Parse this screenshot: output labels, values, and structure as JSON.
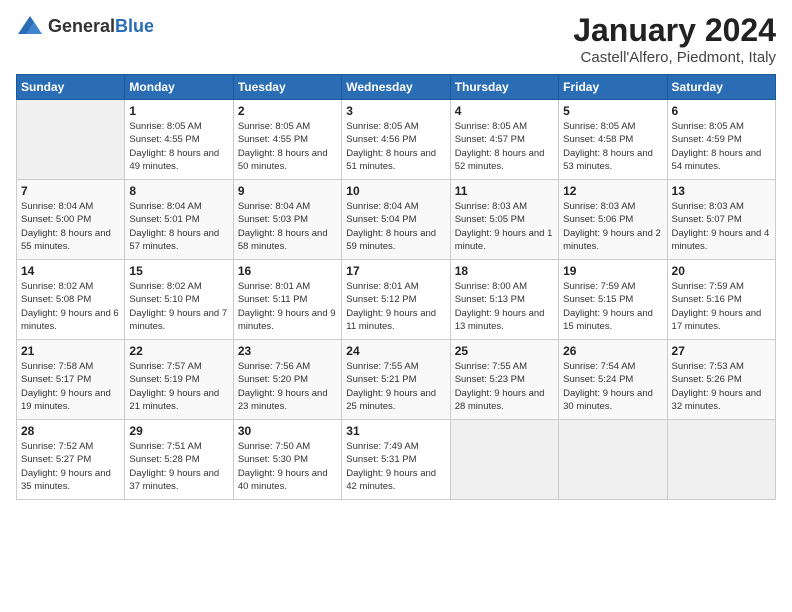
{
  "header": {
    "logo_general": "General",
    "logo_blue": "Blue",
    "month_year": "January 2024",
    "location": "Castell'Alfero, Piedmont, Italy"
  },
  "weekdays": [
    "Sunday",
    "Monday",
    "Tuesday",
    "Wednesday",
    "Thursday",
    "Friday",
    "Saturday"
  ],
  "weeks": [
    [
      {
        "day": "",
        "sunrise": "",
        "sunset": "",
        "daylight": ""
      },
      {
        "day": "1",
        "sunrise": "Sunrise: 8:05 AM",
        "sunset": "Sunset: 4:55 PM",
        "daylight": "Daylight: 8 hours and 49 minutes."
      },
      {
        "day": "2",
        "sunrise": "Sunrise: 8:05 AM",
        "sunset": "Sunset: 4:55 PM",
        "daylight": "Daylight: 8 hours and 50 minutes."
      },
      {
        "day": "3",
        "sunrise": "Sunrise: 8:05 AM",
        "sunset": "Sunset: 4:56 PM",
        "daylight": "Daylight: 8 hours and 51 minutes."
      },
      {
        "day": "4",
        "sunrise": "Sunrise: 8:05 AM",
        "sunset": "Sunset: 4:57 PM",
        "daylight": "Daylight: 8 hours and 52 minutes."
      },
      {
        "day": "5",
        "sunrise": "Sunrise: 8:05 AM",
        "sunset": "Sunset: 4:58 PM",
        "daylight": "Daylight: 8 hours and 53 minutes."
      },
      {
        "day": "6",
        "sunrise": "Sunrise: 8:05 AM",
        "sunset": "Sunset: 4:59 PM",
        "daylight": "Daylight: 8 hours and 54 minutes."
      }
    ],
    [
      {
        "day": "7",
        "sunrise": "Sunrise: 8:04 AM",
        "sunset": "Sunset: 5:00 PM",
        "daylight": "Daylight: 8 hours and 55 minutes."
      },
      {
        "day": "8",
        "sunrise": "Sunrise: 8:04 AM",
        "sunset": "Sunset: 5:01 PM",
        "daylight": "Daylight: 8 hours and 57 minutes."
      },
      {
        "day": "9",
        "sunrise": "Sunrise: 8:04 AM",
        "sunset": "Sunset: 5:03 PM",
        "daylight": "Daylight: 8 hours and 58 minutes."
      },
      {
        "day": "10",
        "sunrise": "Sunrise: 8:04 AM",
        "sunset": "Sunset: 5:04 PM",
        "daylight": "Daylight: 8 hours and 59 minutes."
      },
      {
        "day": "11",
        "sunrise": "Sunrise: 8:03 AM",
        "sunset": "Sunset: 5:05 PM",
        "daylight": "Daylight: 9 hours and 1 minute."
      },
      {
        "day": "12",
        "sunrise": "Sunrise: 8:03 AM",
        "sunset": "Sunset: 5:06 PM",
        "daylight": "Daylight: 9 hours and 2 minutes."
      },
      {
        "day": "13",
        "sunrise": "Sunrise: 8:03 AM",
        "sunset": "Sunset: 5:07 PM",
        "daylight": "Daylight: 9 hours and 4 minutes."
      }
    ],
    [
      {
        "day": "14",
        "sunrise": "Sunrise: 8:02 AM",
        "sunset": "Sunset: 5:08 PM",
        "daylight": "Daylight: 9 hours and 6 minutes."
      },
      {
        "day": "15",
        "sunrise": "Sunrise: 8:02 AM",
        "sunset": "Sunset: 5:10 PM",
        "daylight": "Daylight: 9 hours and 7 minutes."
      },
      {
        "day": "16",
        "sunrise": "Sunrise: 8:01 AM",
        "sunset": "Sunset: 5:11 PM",
        "daylight": "Daylight: 9 hours and 9 minutes."
      },
      {
        "day": "17",
        "sunrise": "Sunrise: 8:01 AM",
        "sunset": "Sunset: 5:12 PM",
        "daylight": "Daylight: 9 hours and 11 minutes."
      },
      {
        "day": "18",
        "sunrise": "Sunrise: 8:00 AM",
        "sunset": "Sunset: 5:13 PM",
        "daylight": "Daylight: 9 hours and 13 minutes."
      },
      {
        "day": "19",
        "sunrise": "Sunrise: 7:59 AM",
        "sunset": "Sunset: 5:15 PM",
        "daylight": "Daylight: 9 hours and 15 minutes."
      },
      {
        "day": "20",
        "sunrise": "Sunrise: 7:59 AM",
        "sunset": "Sunset: 5:16 PM",
        "daylight": "Daylight: 9 hours and 17 minutes."
      }
    ],
    [
      {
        "day": "21",
        "sunrise": "Sunrise: 7:58 AM",
        "sunset": "Sunset: 5:17 PM",
        "daylight": "Daylight: 9 hours and 19 minutes."
      },
      {
        "day": "22",
        "sunrise": "Sunrise: 7:57 AM",
        "sunset": "Sunset: 5:19 PM",
        "daylight": "Daylight: 9 hours and 21 minutes."
      },
      {
        "day": "23",
        "sunrise": "Sunrise: 7:56 AM",
        "sunset": "Sunset: 5:20 PM",
        "daylight": "Daylight: 9 hours and 23 minutes."
      },
      {
        "day": "24",
        "sunrise": "Sunrise: 7:55 AM",
        "sunset": "Sunset: 5:21 PM",
        "daylight": "Daylight: 9 hours and 25 minutes."
      },
      {
        "day": "25",
        "sunrise": "Sunrise: 7:55 AM",
        "sunset": "Sunset: 5:23 PM",
        "daylight": "Daylight: 9 hours and 28 minutes."
      },
      {
        "day": "26",
        "sunrise": "Sunrise: 7:54 AM",
        "sunset": "Sunset: 5:24 PM",
        "daylight": "Daylight: 9 hours and 30 minutes."
      },
      {
        "day": "27",
        "sunrise": "Sunrise: 7:53 AM",
        "sunset": "Sunset: 5:26 PM",
        "daylight": "Daylight: 9 hours and 32 minutes."
      }
    ],
    [
      {
        "day": "28",
        "sunrise": "Sunrise: 7:52 AM",
        "sunset": "Sunset: 5:27 PM",
        "daylight": "Daylight: 9 hours and 35 minutes."
      },
      {
        "day": "29",
        "sunrise": "Sunrise: 7:51 AM",
        "sunset": "Sunset: 5:28 PM",
        "daylight": "Daylight: 9 hours and 37 minutes."
      },
      {
        "day": "30",
        "sunrise": "Sunrise: 7:50 AM",
        "sunset": "Sunset: 5:30 PM",
        "daylight": "Daylight: 9 hours and 40 minutes."
      },
      {
        "day": "31",
        "sunrise": "Sunrise: 7:49 AM",
        "sunset": "Sunset: 5:31 PM",
        "daylight": "Daylight: 9 hours and 42 minutes."
      },
      {
        "day": "",
        "sunrise": "",
        "sunset": "",
        "daylight": ""
      },
      {
        "day": "",
        "sunrise": "",
        "sunset": "",
        "daylight": ""
      },
      {
        "day": "",
        "sunrise": "",
        "sunset": "",
        "daylight": ""
      }
    ]
  ]
}
